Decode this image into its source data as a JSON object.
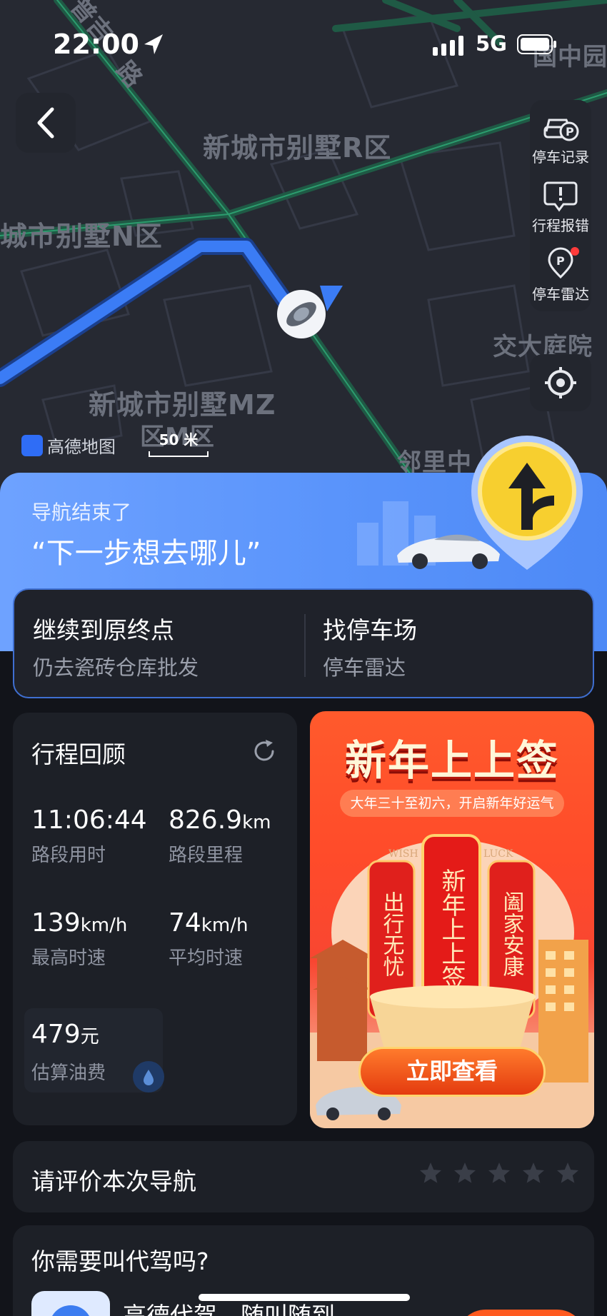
{
  "status_bar": {
    "time": "22:00",
    "network": "5G"
  },
  "map": {
    "labels": [
      "新城市别墅R区",
      "城市别墅N区",
      "新城市别墅MZ",
      "区M区",
      "交大庭院",
      "邻里中",
      "国中园",
      "普吉",
      "路"
    ],
    "brand": "高德地图",
    "scale": "50 米"
  },
  "tools": [
    {
      "label": "停车记录",
      "icon": "parking-record-icon"
    },
    {
      "label": "行程报错",
      "icon": "report-error-icon"
    },
    {
      "label": "停车雷达",
      "icon": "parking-radar-icon",
      "badge": true
    }
  ],
  "banner": {
    "title": "导航结束了",
    "subtitle": "“下一步想去哪儿”"
  },
  "actions": [
    {
      "title": "继续到原终点",
      "subtitle": "仍去瓷砖仓库批发"
    },
    {
      "title": "找停车场",
      "subtitle": "停车雷达"
    }
  ],
  "review": {
    "title": "行程回顾",
    "stats": [
      {
        "value": "11:06:44",
        "unit": "",
        "label": "路段用时"
      },
      {
        "value": "826.9",
        "unit": "km",
        "label": "路段里程"
      },
      {
        "value": "139",
        "unit": "km/h",
        "label": "最高时速"
      },
      {
        "value": "74",
        "unit": "km/h",
        "label": "平均时速"
      }
    ],
    "fuel": {
      "value": "479",
      "unit": "元",
      "label": "估算油费"
    }
  },
  "promo": {
    "title": "新年上上签",
    "subtitle": "大年三十至初六，开启新年好运气",
    "center_slip": "新年上上签",
    "left_slip": "出行无忧",
    "right_slip": "阖家安康",
    "watermark": "WISH YOU GOOD LUCK",
    "button": "立即查看",
    "colors": {
      "primary": "#ff4b2a",
      "gold": "#ffd36d"
    }
  },
  "rating": {
    "title": "请评价本次导航",
    "stars": 5
  },
  "driver": {
    "title": "你需要叫代驾吗?",
    "text": "高德代驾，随叫随到"
  },
  "colors": {
    "accent": "#4d89f6",
    "route": "#3b7cf5",
    "background": "#12141a"
  }
}
